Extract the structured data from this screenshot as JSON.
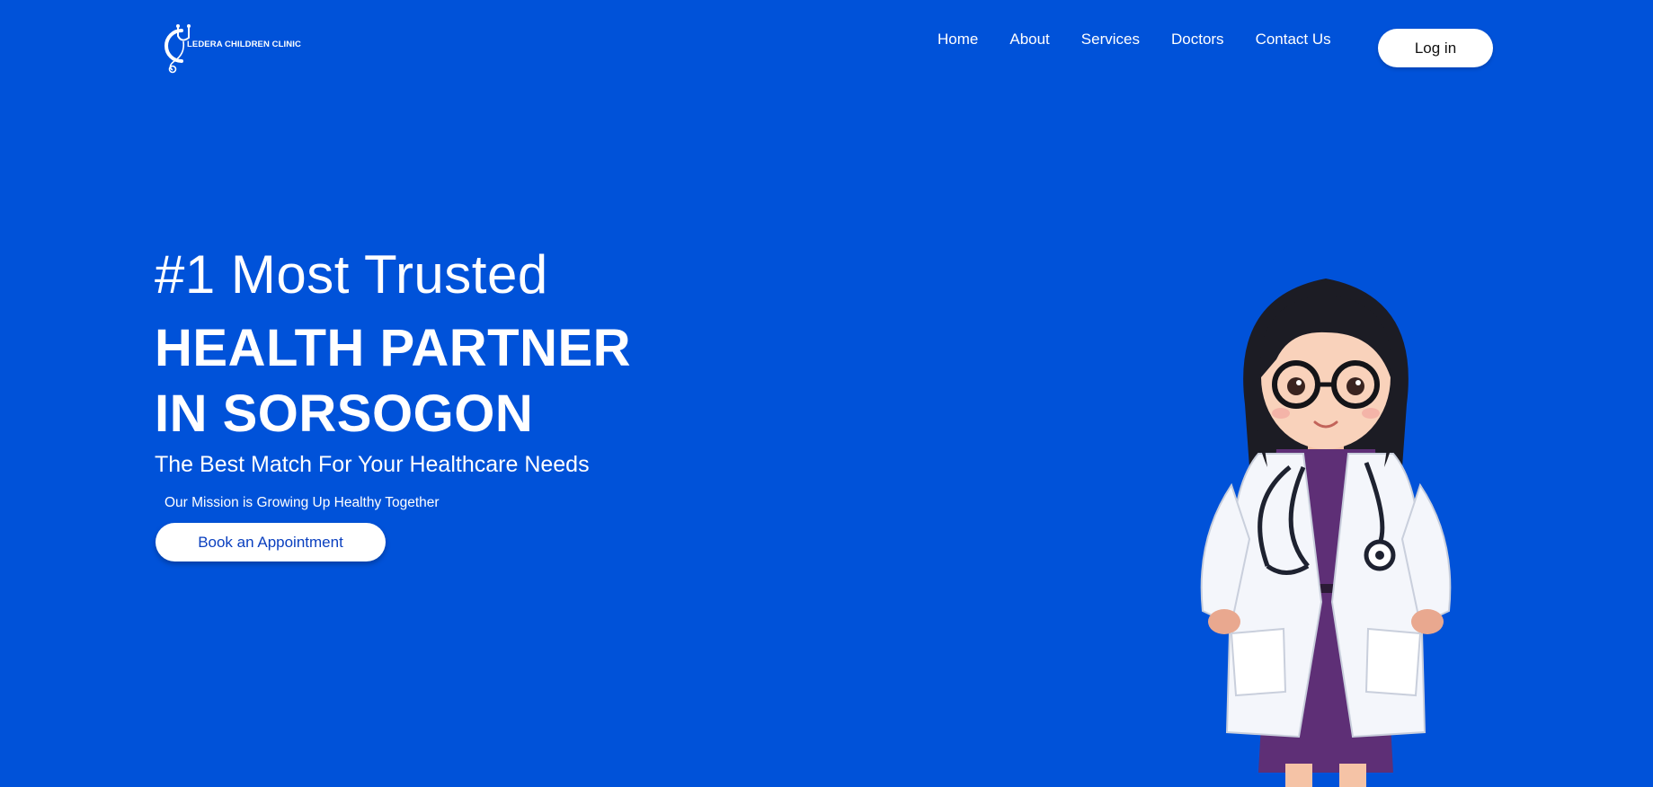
{
  "brand": {
    "name": "LEDERA CHILDREN CLINIC",
    "logo_icon": "stethoscope-c-icon"
  },
  "nav": {
    "items": [
      {
        "label": "Home"
      },
      {
        "label": "About"
      },
      {
        "label": "Services"
      },
      {
        "label": "Doctors"
      },
      {
        "label": "Contact Us"
      }
    ],
    "login_label": "Log in"
  },
  "hero": {
    "line1": "#1 Most Trusted",
    "line2": "HEALTH PARTNER",
    "line3": "IN SORSOGON",
    "subtitle": "The Best Match For Your Healthcare Needs",
    "mission": "Our Mission is Growing Up Healthy Together",
    "cta_label": "Book an Appointment",
    "illustration": "female-doctor-illustration"
  },
  "colors": {
    "background": "#0052d9",
    "text": "#ffffff",
    "button_bg": "#ffffff",
    "cta_text": "#0a3fbf"
  }
}
